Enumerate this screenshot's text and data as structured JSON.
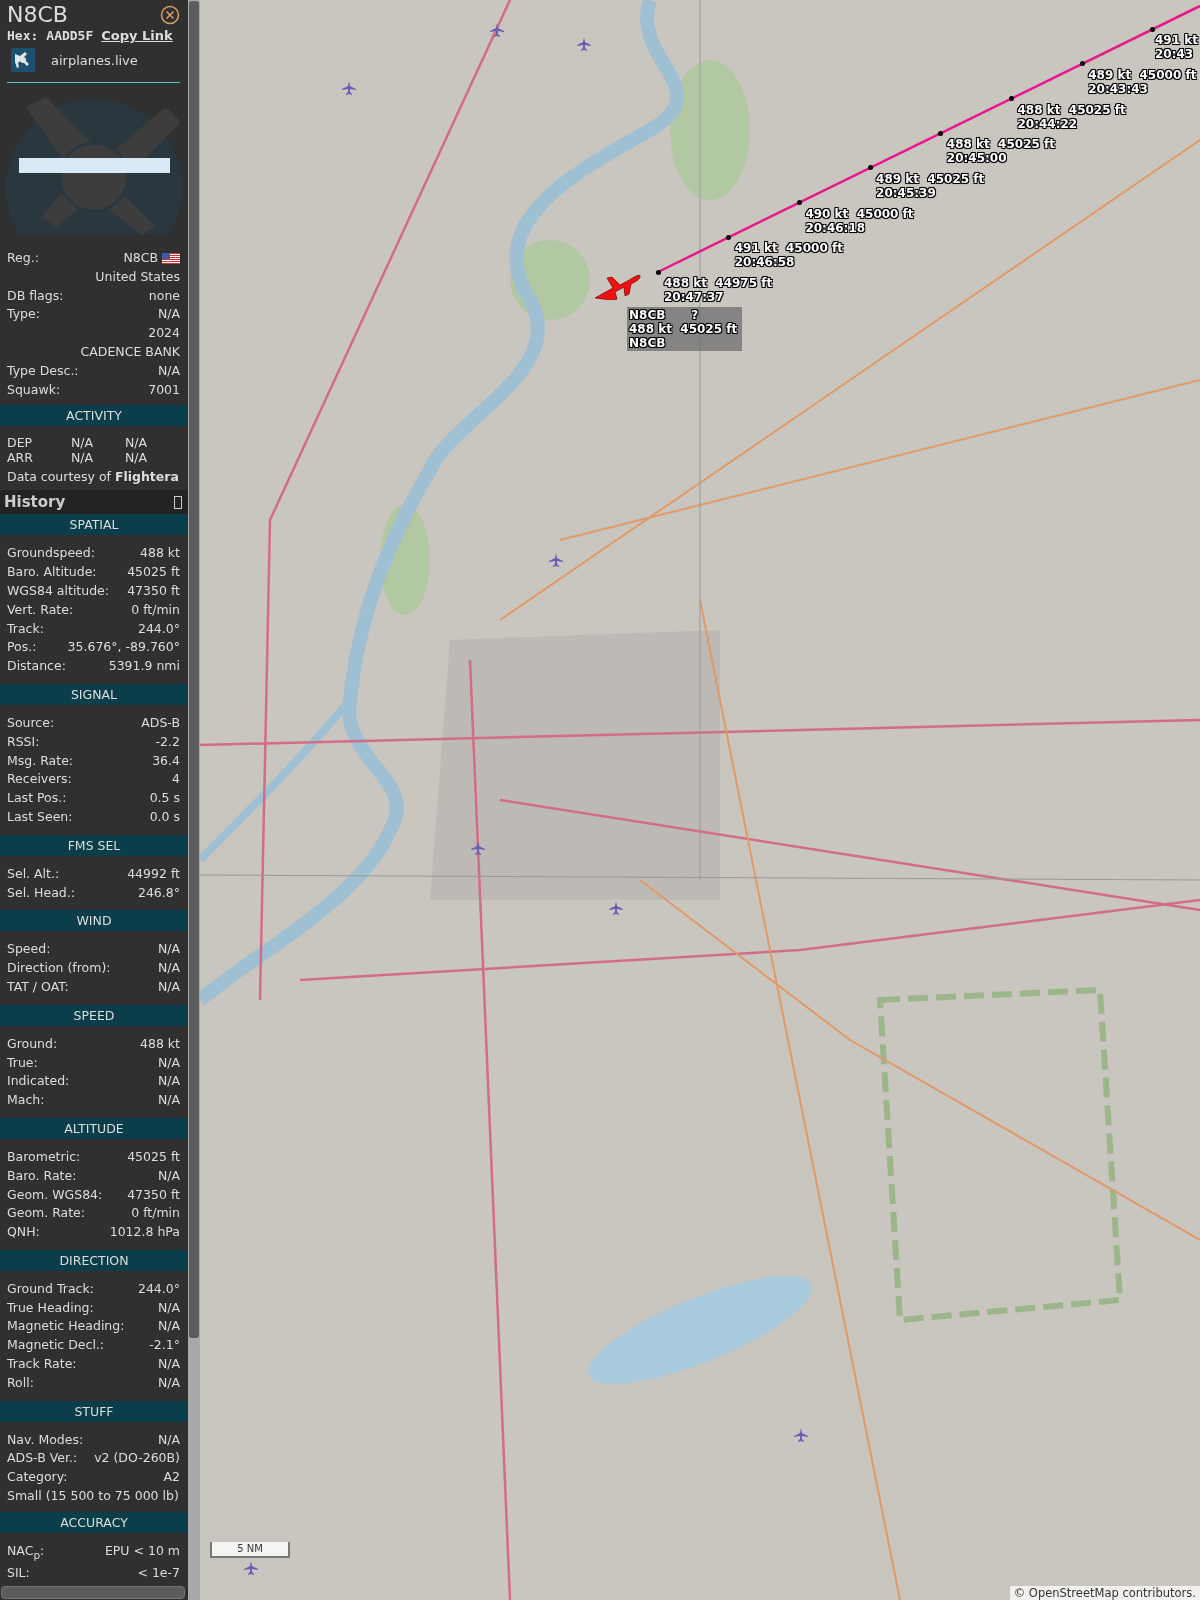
{
  "panel": {
    "title": "N8CB",
    "hex_label": "Hex:",
    "hex": "AADD5F",
    "copy_link": "Copy Link",
    "source": "airplanes.live",
    "registration": {
      "label": "Reg.:",
      "value": "N8CB"
    },
    "info_rows": [
      {
        "value": "United States"
      },
      {
        "label": "DB flags:",
        "value": "none"
      },
      {
        "label": "Type:",
        "value": "N/A"
      },
      {
        "value": "2024"
      },
      {
        "value": "CADENCE BANK"
      },
      {
        "label": "Type Desc.:",
        "value": "N/A"
      },
      {
        "label": "Squawk:",
        "value": "7001"
      }
    ],
    "activity": {
      "title": "ACTIVITY",
      "rows": [
        [
          "DEP",
          "N/A",
          "N/A"
        ],
        [
          "ARR",
          "N/A",
          "N/A"
        ]
      ],
      "courtesy": "Data courtesy of **Flightera**"
    },
    "history": {
      "title": "History"
    },
    "sections": [
      {
        "title": "SPATIAL",
        "rows": [
          {
            "label": "Groundspeed:",
            "value": "488 kt"
          },
          {
            "label": "Baro. Altitude:",
            "value": "45025 ft"
          },
          {
            "label": "WGS84 altitude:",
            "value": "47350 ft"
          },
          {
            "label": "Vert. Rate:",
            "value": "0 ft/min"
          },
          {
            "label": "Track:",
            "value": "244.0°"
          },
          {
            "label": "Pos.:",
            "value": "35.676°, -89.760°"
          },
          {
            "label": "Distance:",
            "value": "5391.9 nmi"
          }
        ]
      },
      {
        "title": "SIGNAL",
        "rows": [
          {
            "label": "Source:",
            "value": "ADS-B"
          },
          {
            "label": "RSSI:",
            "value": "-2.2"
          },
          {
            "label": "Msg. Rate:",
            "value": "36.4"
          },
          {
            "label": "Receivers:",
            "value": "4"
          },
          {
            "label": "Last Pos.:",
            "value": "0.5 s"
          },
          {
            "label": "Last Seen:",
            "value": "0.0 s"
          }
        ]
      },
      {
        "title": "FMS SEL",
        "rows": [
          {
            "label": "Sel. Alt.:",
            "value": "44992 ft"
          },
          {
            "label": "Sel. Head.:",
            "value": "246.8°"
          }
        ]
      },
      {
        "title": "WIND",
        "rows": [
          {
            "label": "Speed:",
            "value": "N/A"
          },
          {
            "label": "Direction (from):",
            "value": "N/A"
          },
          {
            "label": "TAT / OAT:",
            "value": "N/A"
          }
        ]
      },
      {
        "title": "SPEED",
        "rows": [
          {
            "label": "Ground:",
            "value": "488 kt"
          },
          {
            "label": "True:",
            "value": "N/A"
          },
          {
            "label": "Indicated:",
            "value": "N/A"
          },
          {
            "label": "Mach:",
            "value": "N/A"
          }
        ]
      },
      {
        "title": "ALTITUDE",
        "rows": [
          {
            "label": "Barometric:",
            "value": "45025 ft"
          },
          {
            "label": "Baro. Rate:",
            "value": "N/A"
          },
          {
            "label": "Geom. WGS84:",
            "value": "47350 ft"
          },
          {
            "label": "Geom. Rate:",
            "value": "0 ft/min"
          },
          {
            "label": "QNH:",
            "value": "1012.8 hPa"
          }
        ]
      },
      {
        "title": "DIRECTION",
        "rows": [
          {
            "label": "Ground Track:",
            "value": "244.0°"
          },
          {
            "label": "True Heading:",
            "value": "N/A"
          },
          {
            "label": "Magnetic Heading:",
            "value": "N/A"
          },
          {
            "label": "Magnetic Decl.:",
            "value": "-2.1°"
          },
          {
            "label": "Track Rate:",
            "value": "N/A"
          },
          {
            "label": "Roll:",
            "value": "N/A"
          }
        ]
      },
      {
        "title": "STUFF",
        "rows": [
          {
            "label": "Nav. Modes:",
            "value": "N/A"
          },
          {
            "label": "ADS-B Ver.:",
            "value": "v2 (DO-260B)"
          },
          {
            "label": "Category:",
            "value": "A2"
          },
          {
            "note": "Small (15 500 to 75 000 lb)"
          }
        ]
      },
      {
        "title": "ACCURACY",
        "rows": [
          {
            "label": "NAC$_{p}$:",
            "value": "EPU < 10 m"
          },
          {
            "label": "SIL:",
            "value": "< 1e-7"
          }
        ]
      }
    ]
  },
  "map": {
    "track": [
      {
        "speed_altitude": "491 kt",
        "time": "20:43"
      },
      {
        "speed_altitude": "489 kt  45000 ft",
        "time": "20:43:43"
      },
      {
        "speed_altitude": "488 kt  45025 ft",
        "time": "20:44:22"
      },
      {
        "speed_altitude": "488 kt  45025 ft",
        "time": "20:45:00"
      },
      {
        "speed_altitude": "489 kt  45025 ft",
        "time": "20:45:39"
      },
      {
        "speed_altitude": "490 kt  45000 ft",
        "time": "20:46:18"
      },
      {
        "speed_altitude": "491 kt  45000 ft",
        "time": "20:46:58"
      },
      {
        "speed_altitude": "488 kt  44975 ft",
        "time": "20:47:37"
      }
    ],
    "aircraft_label": {
      "callsign": "N8CB",
      "type": "?",
      "speed_altitude": "488 kt  45025 ft",
      "registration": "N8CB"
    },
    "scale": "5 NM",
    "attribution": "© OpenStreetMap contributors."
  }
}
